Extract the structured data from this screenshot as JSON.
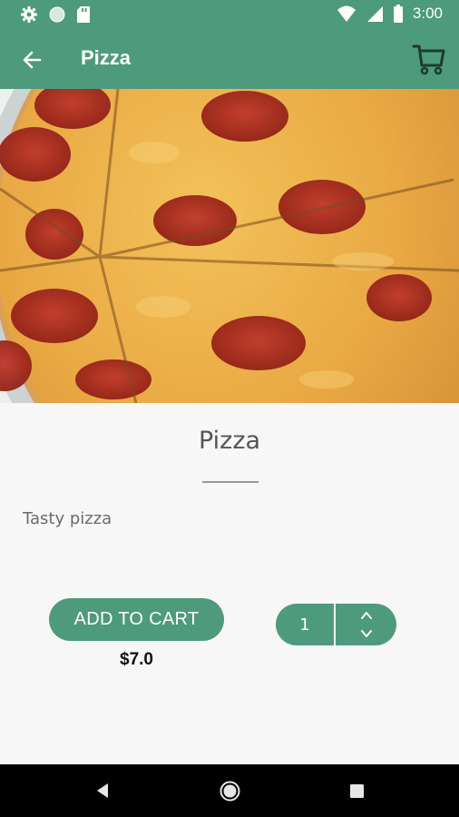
{
  "status_bar": {
    "time": "3:00",
    "icons": [
      "settings-icon",
      "circle-icon",
      "sd-card-icon",
      "wifi-icon",
      "cell-signal-icon",
      "battery-icon"
    ]
  },
  "app_bar": {
    "title": "Pizza",
    "back_icon": "arrow-left-icon",
    "cart_icon": "cart-icon"
  },
  "product": {
    "image": "pepperoni-pizza-photo",
    "title": "Pizza",
    "description": "Tasty pizza",
    "price": "$7.0"
  },
  "actions": {
    "add_to_cart_label": "ADD TO CART",
    "quantity": "1"
  },
  "colors": {
    "primary": "#4e9a7c",
    "background": "#f7f7f7",
    "nav_bar": "#000000"
  },
  "nav_bar": {
    "icons": [
      "nav-back-icon",
      "nav-home-icon",
      "nav-recents-icon"
    ]
  }
}
